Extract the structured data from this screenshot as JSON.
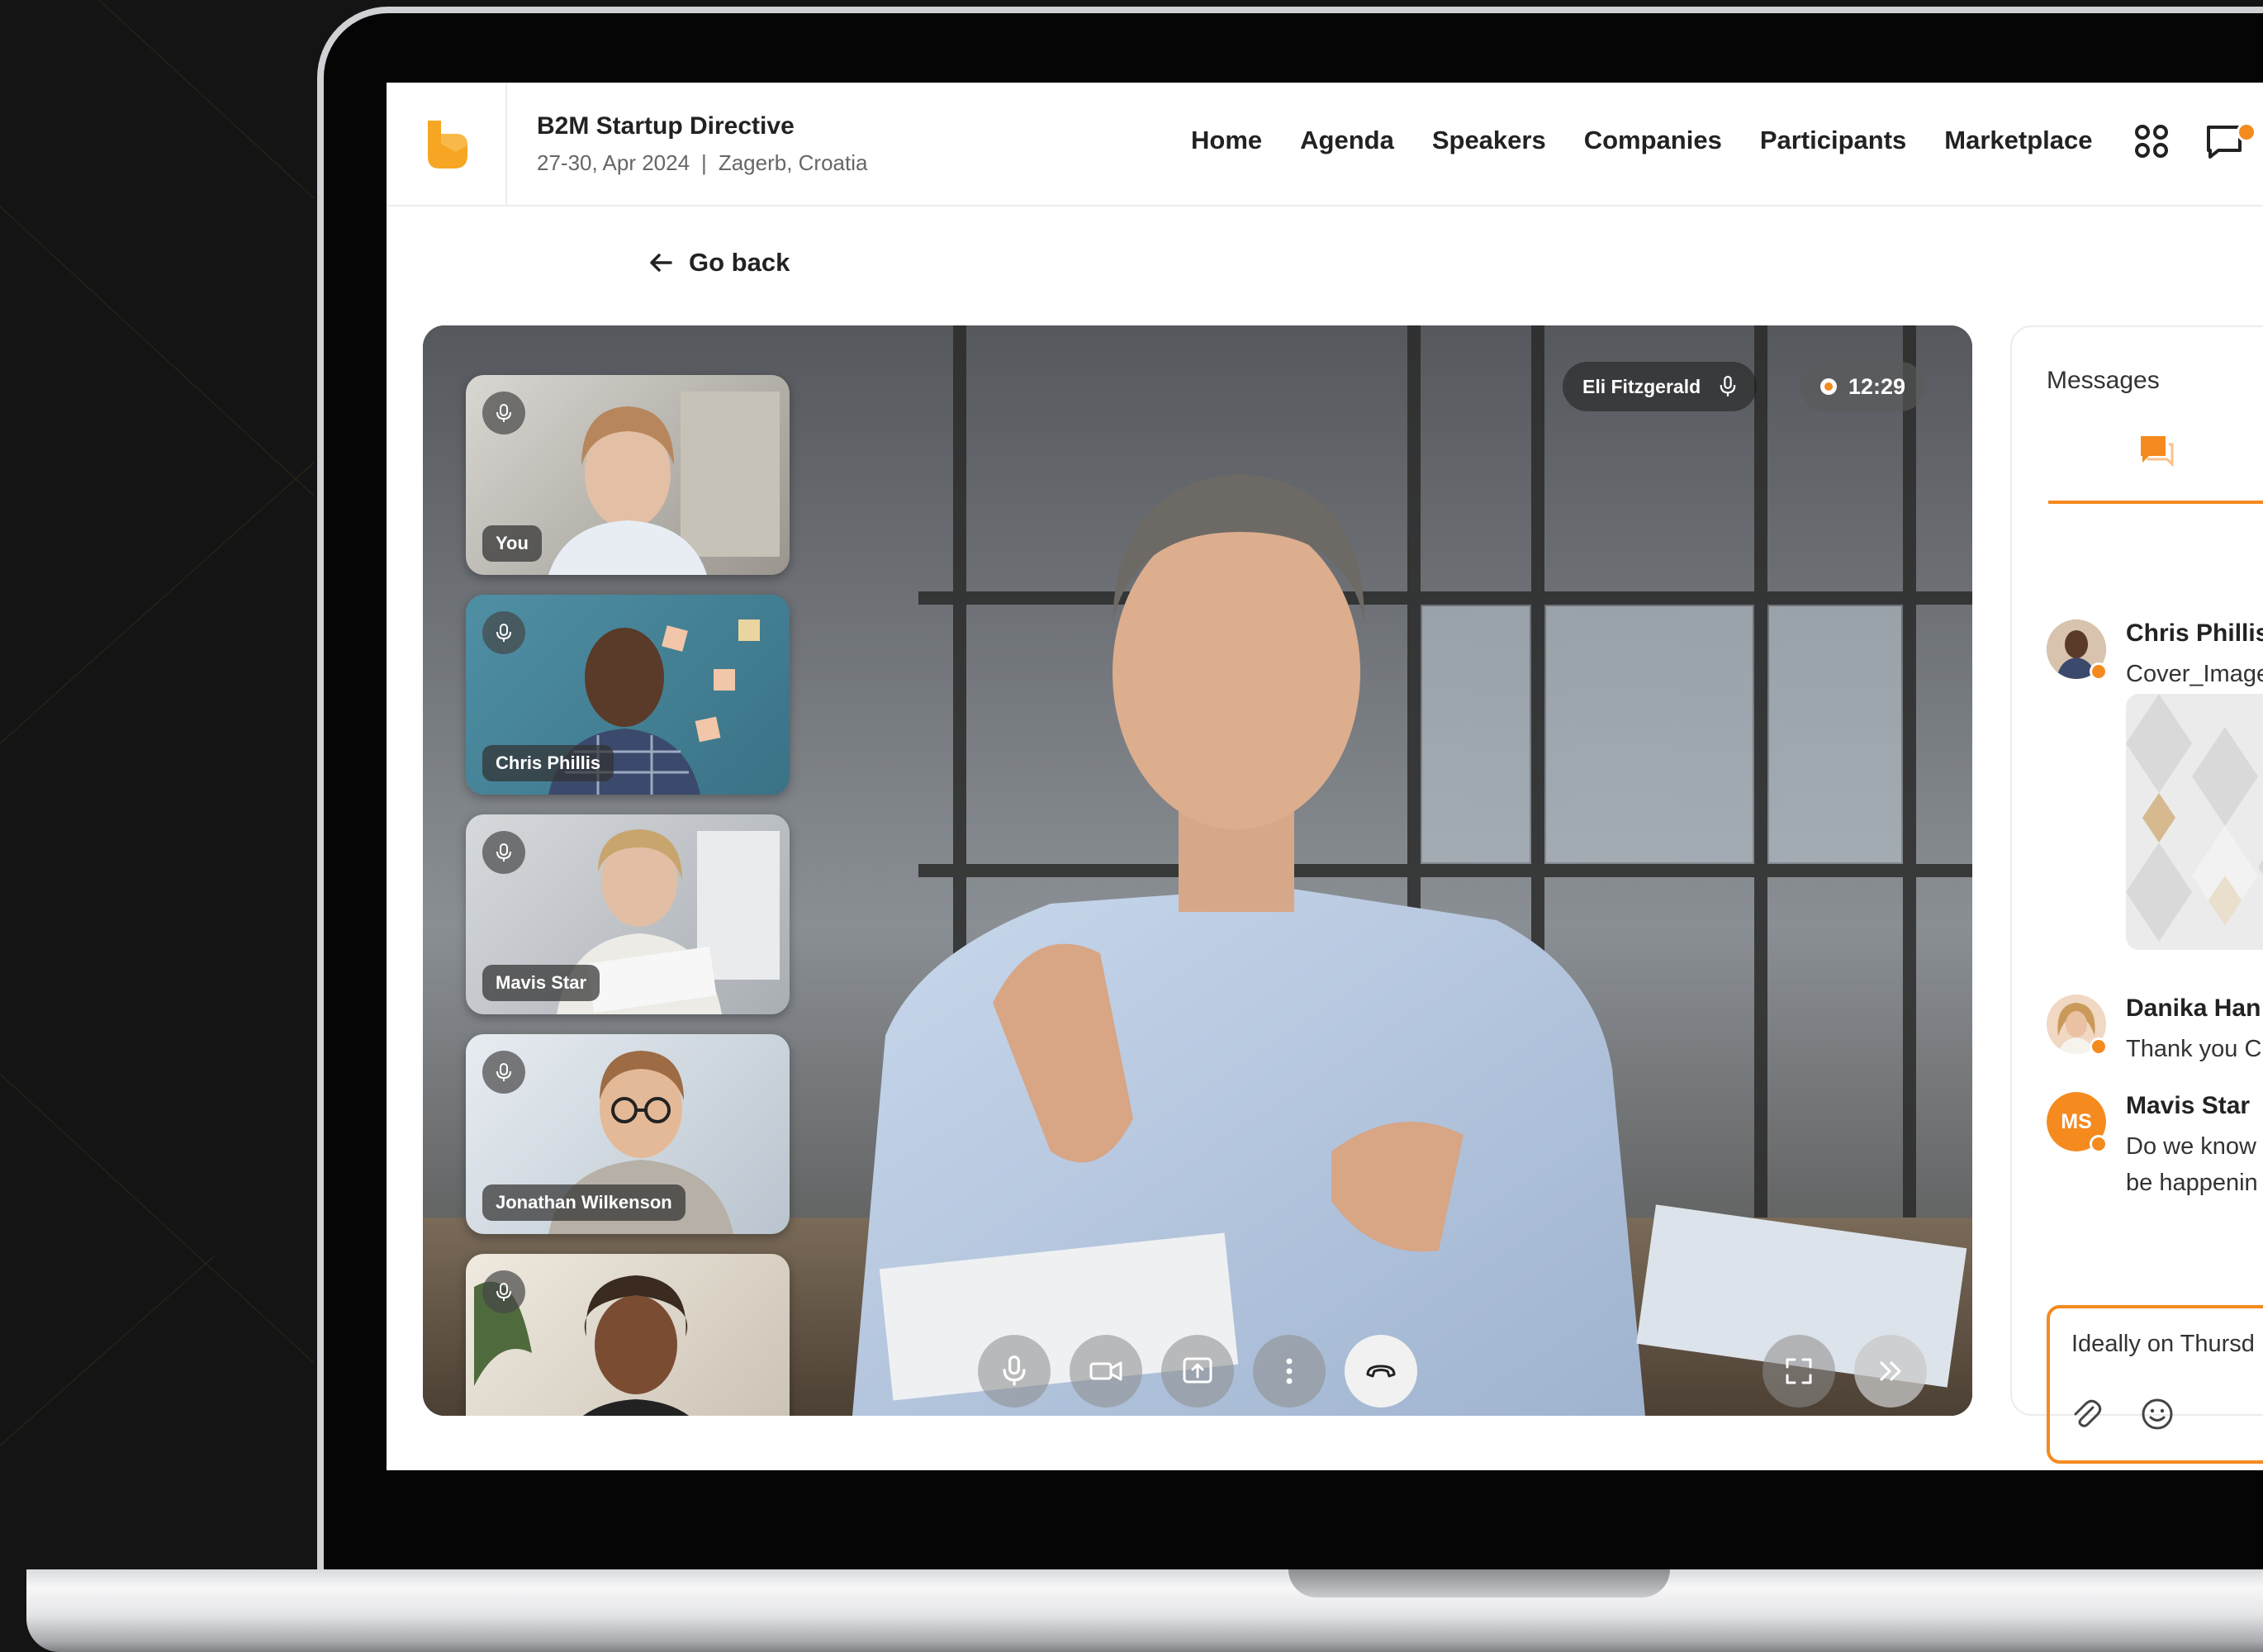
{
  "event": {
    "title": "B2M Startup Directive",
    "dates": "27-30, Apr 2024",
    "separator": "|",
    "location": "Zagerb, Croatia"
  },
  "nav": {
    "items": [
      "Home",
      "Agenda",
      "Speakers",
      "Companies",
      "Participants",
      "Marketplace"
    ]
  },
  "header_icons": [
    "apps-grid-icon",
    "chat-icon"
  ],
  "go_back": {
    "label": "Go back",
    "icon": "arrow-left-icon"
  },
  "call": {
    "speaker_name": "Eli Fitzgerald",
    "timer": "12:29",
    "participants": [
      {
        "name": "You"
      },
      {
        "name": "Chris Phillis"
      },
      {
        "name": "Mavis Star"
      },
      {
        "name": "Jonathan Wilkenson"
      },
      {
        "name": ""
      }
    ],
    "controls": [
      "mic-icon",
      "camera-icon",
      "share-screen-icon",
      "more-icon",
      "end-call-icon",
      "fullscreen-icon",
      "expand-panel-icon"
    ]
  },
  "messages": {
    "title": "Messages",
    "tab_icon": "chat-bubble-icon",
    "items": [
      {
        "author": "Chris Phillis",
        "text": "Cover_Image",
        "has_attachment": true
      },
      {
        "author": "Danika Han",
        "text": "Thank you C"
      },
      {
        "author": "Mavis Star",
        "initials": "MS",
        "text_line1": "Do we know",
        "text_line2": "be happenin"
      }
    ],
    "composer": {
      "value": "Ideally on Thursd",
      "attach_icon": "paperclip-icon",
      "emoji_icon": "emoji-icon"
    }
  },
  "colors": {
    "accent": "#f58a1f",
    "background": "#141414"
  }
}
